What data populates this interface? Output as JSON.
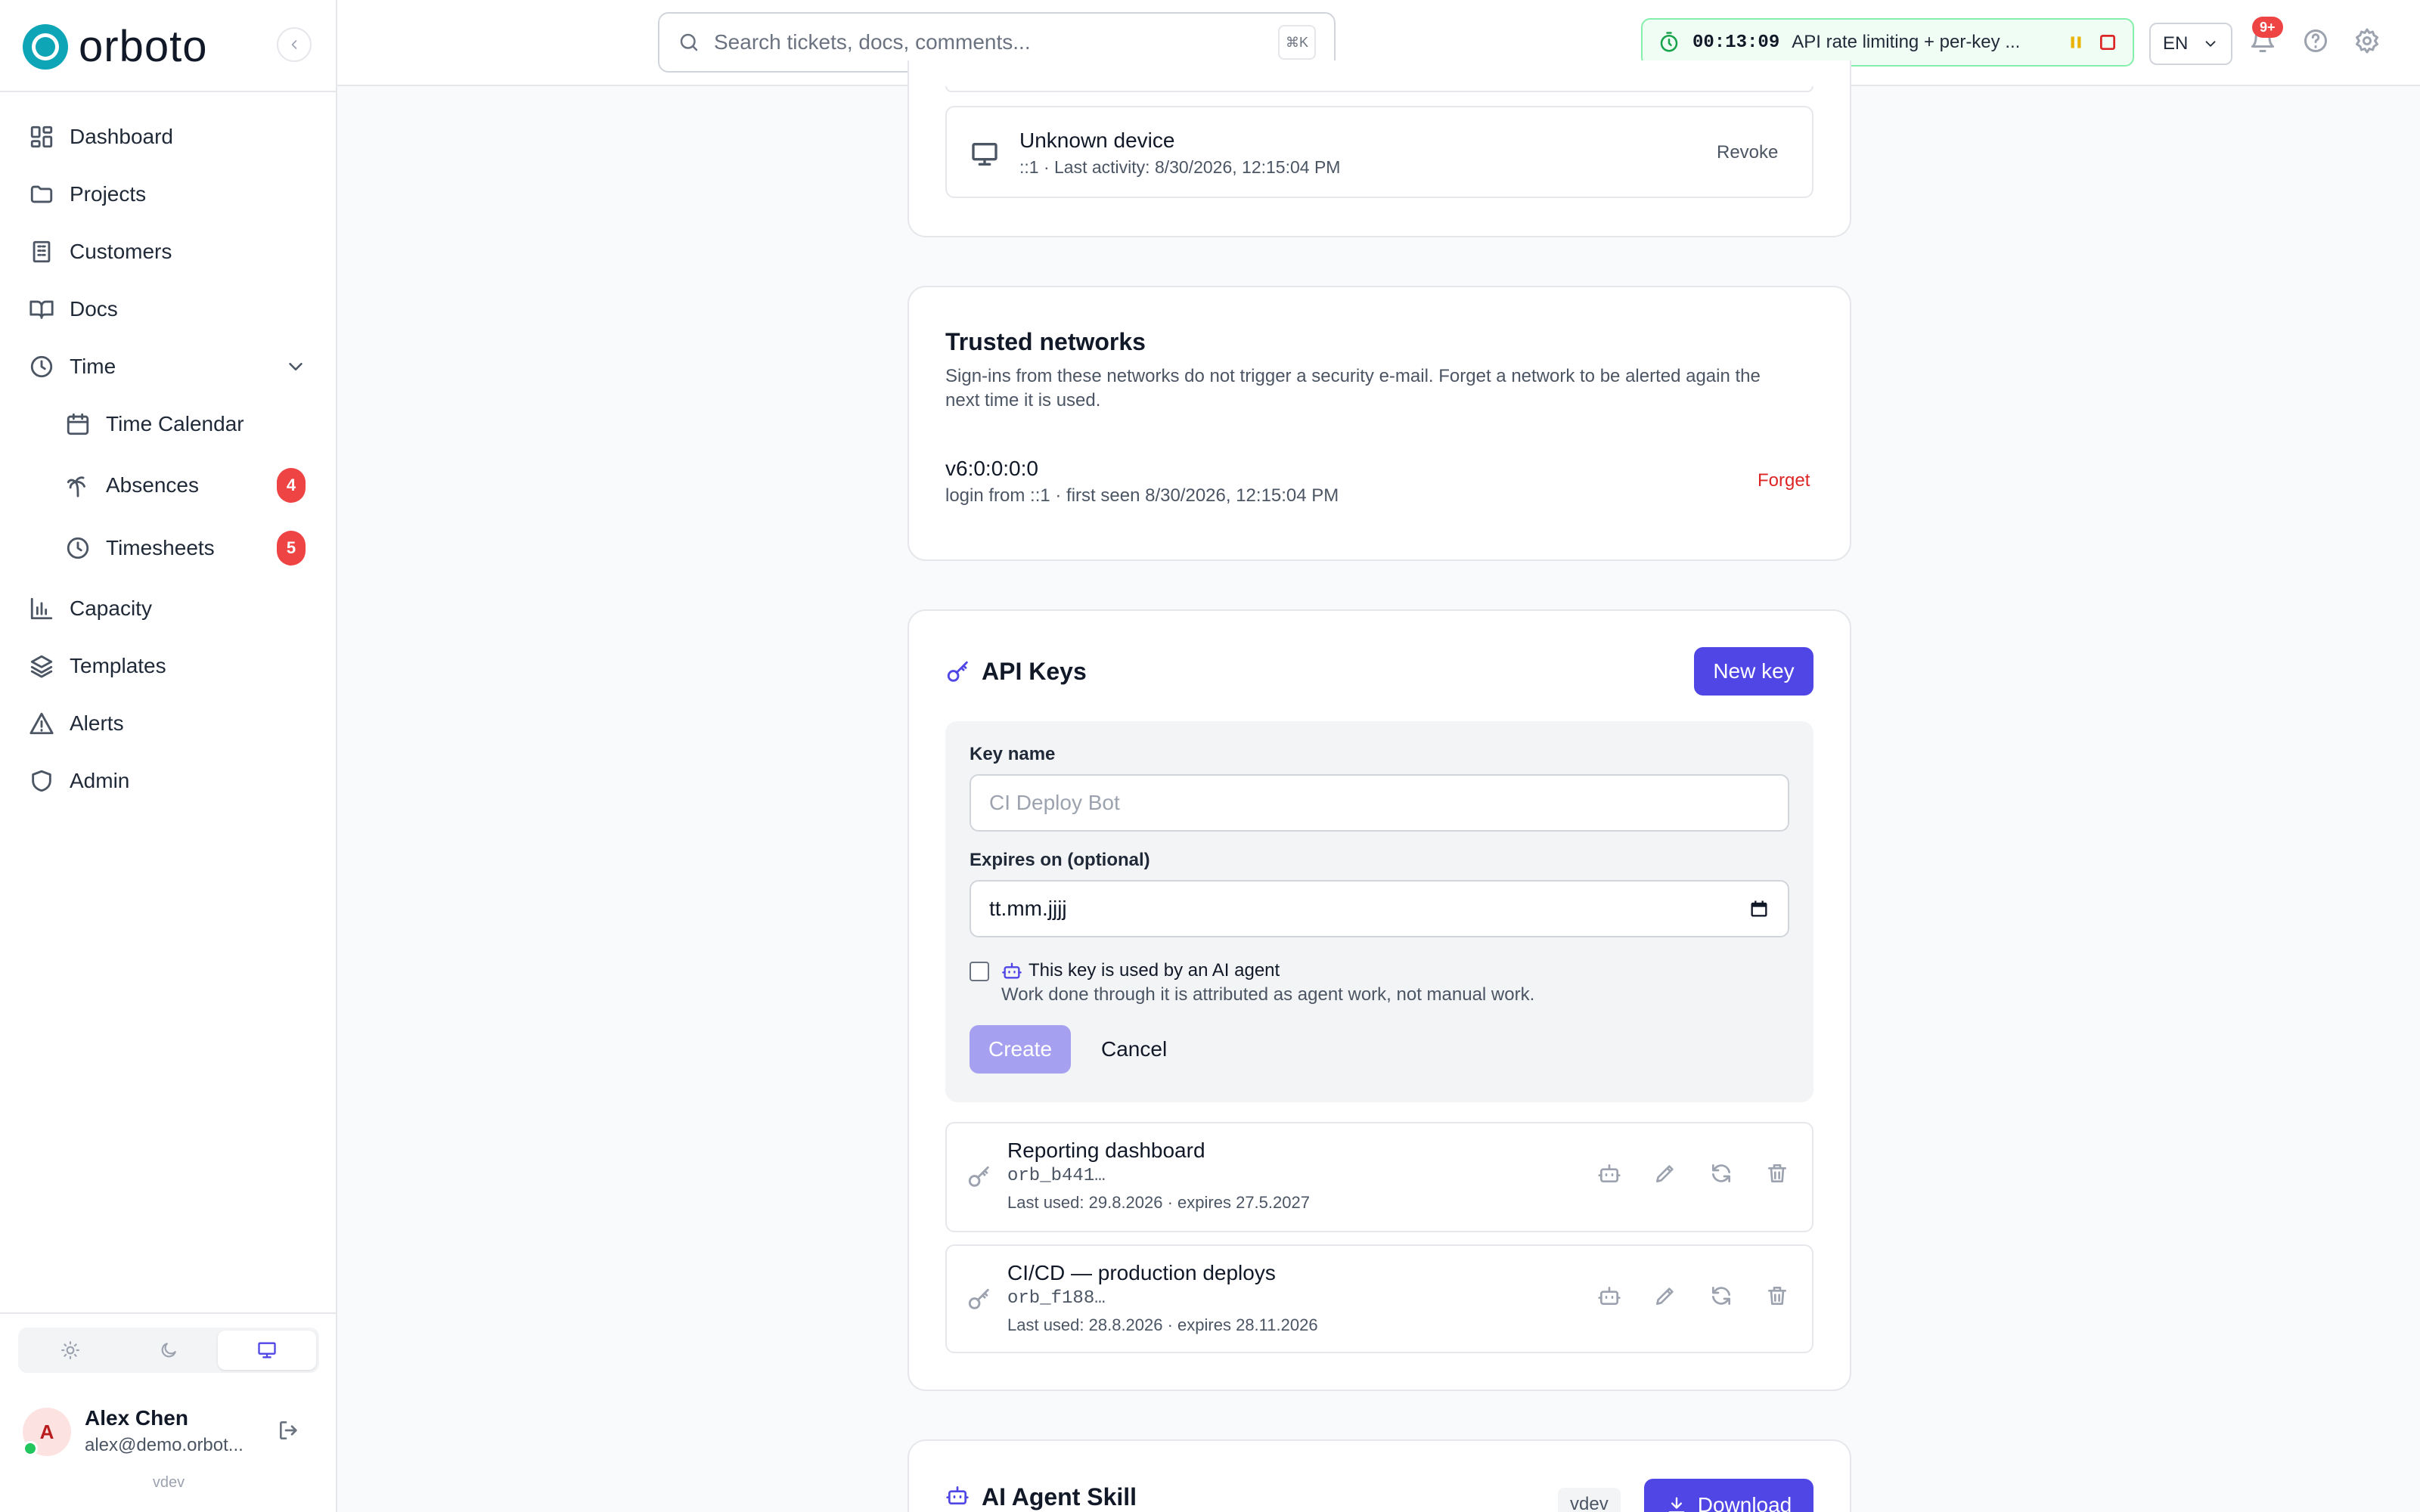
{
  "app": {
    "logo_text": "orboto",
    "version": "vdev"
  },
  "sidebar": {
    "nav": [
      {
        "label": "Dashboard",
        "icon": "dashboard-icon"
      },
      {
        "label": "Projects",
        "icon": "folder-icon"
      },
      {
        "label": "Customers",
        "icon": "building-icon"
      },
      {
        "label": "Docs",
        "icon": "book-icon"
      },
      {
        "label": "Time",
        "icon": "clock-icon"
      },
      {
        "label": "Time Calendar",
        "icon": "calendar-icon"
      },
      {
        "label": "Absences",
        "icon": "palm-tree-icon",
        "badge": "4"
      },
      {
        "label": "Timesheets",
        "icon": "clock-icon",
        "badge": "5"
      },
      {
        "label": "Capacity",
        "icon": "bar-chart-icon"
      },
      {
        "label": "Templates",
        "icon": "layers-icon"
      },
      {
        "label": "Alerts",
        "icon": "alert-triangle-icon"
      },
      {
        "label": "Admin",
        "icon": "shield-icon"
      }
    ],
    "user": {
      "initial": "A",
      "name": "Alex Chen",
      "email": "alex@demo.orbot..."
    }
  },
  "topbar": {
    "search_placeholder": "Search tickets, docs, comments...",
    "search_shortcut": "⌘K",
    "timer_time": "00:13:09",
    "timer_task": "API rate limiting + per-key ...",
    "language": "EN",
    "notif_count": "9+"
  },
  "sessions": {
    "device_name": "Unknown device",
    "device_meta": "::1 · Last activity: 8/30/2026, 12:15:04 PM",
    "revoke_label": "Revoke"
  },
  "trusted": {
    "title": "Trusted networks",
    "description": "Sign-ins from these networks do not trigger a security e-mail. Forget a network to be alerted again the next time it is used.",
    "network": "v6:0:0:0:0",
    "network_meta": "login from ::1 · first seen 8/30/2026, 12:15:04 PM",
    "forget_label": "Forget"
  },
  "api_keys": {
    "title": "API Keys",
    "new_key_label": "New key",
    "form": {
      "name_label": "Key name",
      "name_placeholder": "CI Deploy Bot",
      "expires_label": "Expires on (optional)",
      "expires_value": "tt.mm.jjjj",
      "agent_label": "This key is used by an AI agent",
      "agent_hint": "Work done through it is attributed as agent work, not manual work.",
      "create_label": "Create",
      "cancel_label": "Cancel"
    },
    "keys": [
      {
        "name": "Reporting dashboard",
        "prefix": "orb_b441…",
        "meta": "Last used: 29.8.2026 · expires 27.5.2027"
      },
      {
        "name": "CI/CD — production deploys",
        "prefix": "orb_f188…",
        "meta": "Last used: 28.8.2026 · expires 28.11.2026"
      }
    ]
  },
  "agent_skill": {
    "title": "AI Agent Skill",
    "version": "vdev",
    "download_label": "Download"
  },
  "colors": {
    "accent": "#4f46e5",
    "brand": "#0ea5b7",
    "danger": "#ef4444",
    "timer_border": "#86efac"
  }
}
